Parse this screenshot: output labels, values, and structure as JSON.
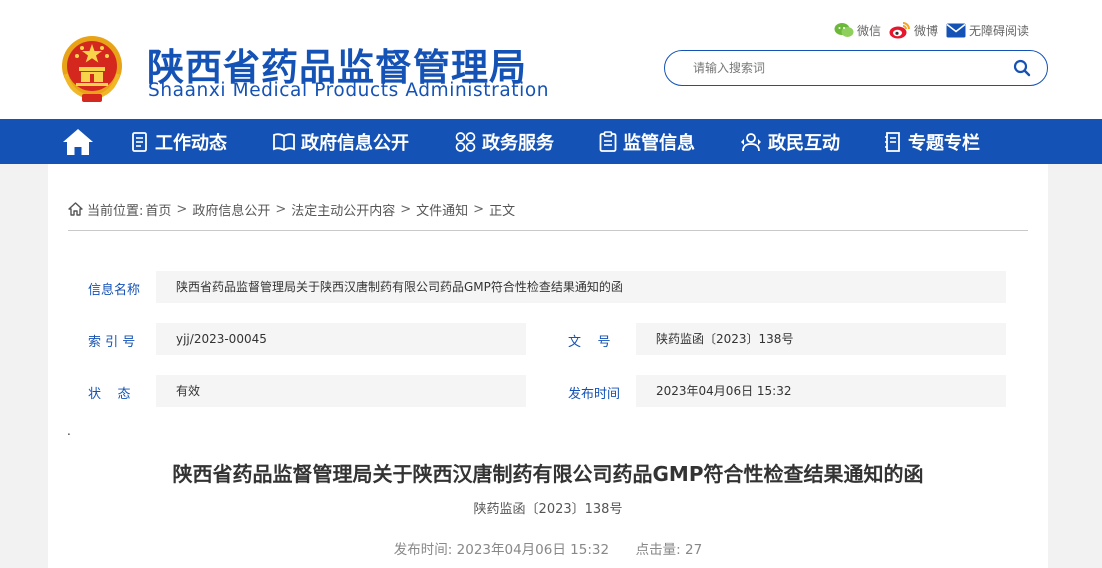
{
  "header": {
    "title": "陕西省药品监督管理局",
    "subtitle": "Shaanxi Medical Products Administration",
    "top_links": {
      "wechat": "微信",
      "weibo": "微博",
      "accessibility": "无障碍阅读"
    },
    "search": {
      "placeholder": "请输入搜索词"
    }
  },
  "nav": {
    "items": [
      {
        "label": "工作动态",
        "icon": "document-list-icon"
      },
      {
        "label": "政府信息公开",
        "icon": "open-book-icon"
      },
      {
        "label": "政务服务",
        "icon": "grid-circles-icon"
      },
      {
        "label": "监管信息",
        "icon": "clipboard-icon"
      },
      {
        "label": "政民互动",
        "icon": "people-interaction-icon"
      },
      {
        "label": "专题专栏",
        "icon": "notebook-icon"
      }
    ]
  },
  "breadcrumb": {
    "prefix": "当前位置:",
    "items": [
      "首页",
      "政府信息公开",
      "法定主动公开内容",
      "文件通知",
      "正文"
    ],
    "separator": ">"
  },
  "info": {
    "name_label": "信息名称",
    "name_value": "陕西省药品监督管理局关于陕西汉唐制药有限公司药品GMP符合性检查结果通知的函",
    "index_label": "索 引 号",
    "index_value": "yjj/2023-00045",
    "docno_label": "文    号",
    "docno_value": "陕药监函〔2023〕138号",
    "status_label": "状    态",
    "status_value": "有效",
    "date_label": "发布时间",
    "date_value": "2023年04月06日 15:32"
  },
  "article": {
    "dot": ".",
    "title": "陕西省药品监督管理局关于陕西汉唐制药有限公司药品GMP符合性检查结果通知的函",
    "doc_no": "陕药监函〔2023〕138号",
    "publish_label": "发布时间:",
    "publish_time": "2023年04月06日 15:32",
    "clicks_label": "点击量:",
    "clicks": "27"
  },
  "colors": {
    "brand": "#1452b5",
    "panel": "#ffffff",
    "background": "#f2f2f2",
    "field": "#f5f5f5"
  }
}
